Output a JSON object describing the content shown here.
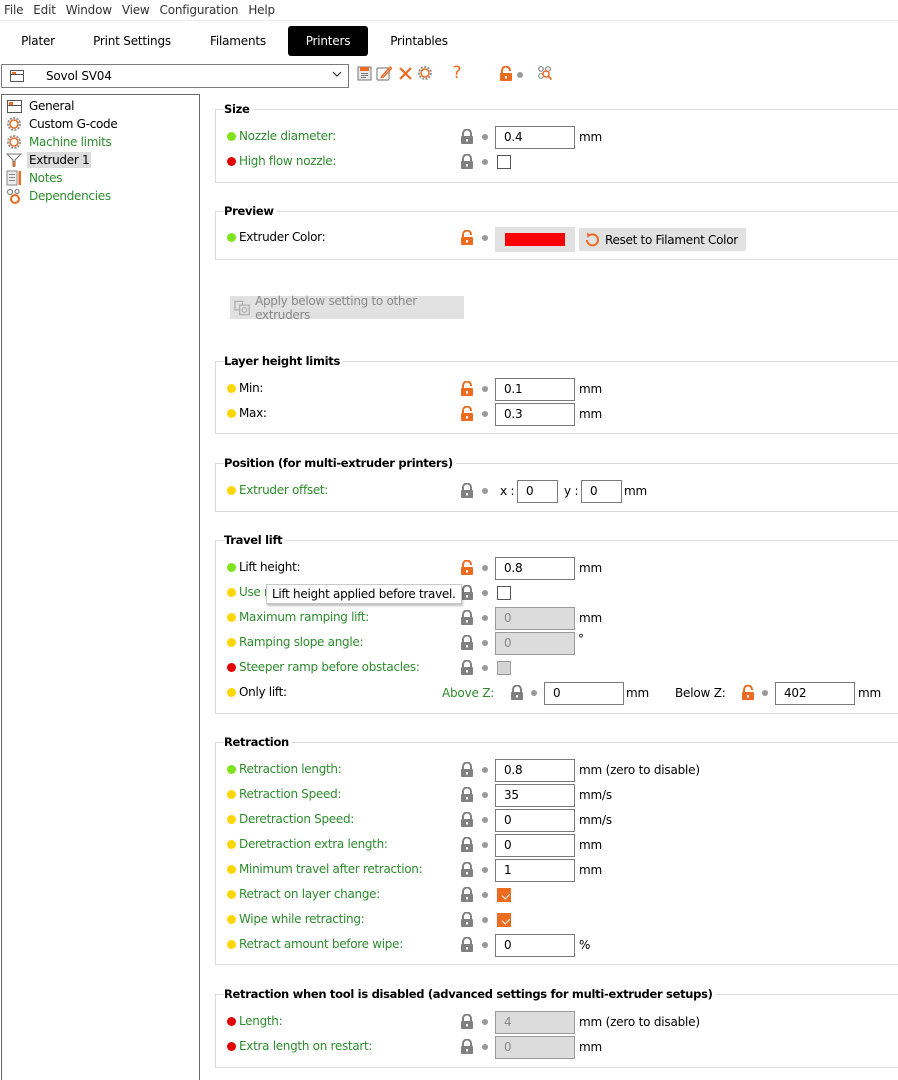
{
  "menubar": [
    "File",
    "Edit",
    "Window",
    "View",
    "Configuration",
    "Help"
  ],
  "tabs": [
    {
      "label": "Plater",
      "active": false
    },
    {
      "label": "Print Settings",
      "active": false
    },
    {
      "label": "Filaments",
      "active": false
    },
    {
      "label": "Printers",
      "active": true
    },
    {
      "label": "Printables",
      "active": false
    }
  ],
  "preset": {
    "name": "Sovol SV04",
    "toolbar_icons": [
      "save-icon",
      "edit-icon",
      "delete-icon",
      "compare-icon",
      "help-icon",
      "lock-unlocked-icon",
      "bullet-icon",
      "search-icon"
    ]
  },
  "sidebar": {
    "items": [
      {
        "label": "General",
        "icon": "printer-icon",
        "modified": false,
        "selected": false
      },
      {
        "label": "Custom G-code",
        "icon": "gear-icon",
        "modified": false,
        "selected": false
      },
      {
        "label": "Machine limits",
        "icon": "gear-icon",
        "modified": true,
        "selected": false
      },
      {
        "label": "Extruder 1",
        "icon": "funnel-icon",
        "modified": false,
        "selected": true
      },
      {
        "label": "Notes",
        "icon": "notes-icon",
        "modified": true,
        "selected": false
      },
      {
        "label": "Dependencies",
        "icon": "dependencies-icon",
        "modified": true,
        "selected": false
      }
    ]
  },
  "colors": {
    "accent": "#ed6b21",
    "modified_label": "#2e8b2e",
    "mode_simple": "#7fe41c",
    "mode_advanced": "#ffd700",
    "mode_expert": "#e00000",
    "extruder_color": "#ff0000"
  },
  "size": {
    "title": "Size",
    "nozzle_diameter": {
      "label": "Nozzle diameter:",
      "value": "0.4",
      "unit": "mm"
    },
    "high_flow_nozzle": {
      "label": "High flow nozzle:",
      "checked": false
    }
  },
  "preview": {
    "title": "Preview",
    "extruder_color": {
      "label": "Extruder Color:",
      "color": "#ff0000"
    },
    "reset_button": "Reset to Filament Color"
  },
  "apply_button": "Apply below setting to other extruders",
  "layer_height": {
    "title": "Layer height limits",
    "min": {
      "label": "Min:",
      "value": "0.1",
      "unit": "mm"
    },
    "max": {
      "label": "Max:",
      "value": "0.3",
      "unit": "mm"
    }
  },
  "position": {
    "title": "Position (for multi-extruder printers)",
    "extruder_offset": {
      "label": "Extruder offset:",
      "x_label": "x :",
      "x": "0",
      "y_label": "y :",
      "y": "0",
      "unit": "mm"
    }
  },
  "travel_lift": {
    "title": "Travel lift",
    "lift_height": {
      "label": "Lift height:",
      "value": "0.8",
      "unit": "mm"
    },
    "use_ramping": {
      "label": "Use r",
      "checked": false
    },
    "tooltip": "Lift height applied before travel.",
    "max_ramping_lift": {
      "label": "Maximum ramping lift:",
      "value": "0",
      "unit": "mm"
    },
    "ramping_slope": {
      "label": "Ramping slope angle:",
      "value": "0",
      "unit": "°"
    },
    "steeper_ramp": {
      "label": "Steeper ramp before obstacles:",
      "checked": false
    },
    "only_lift": {
      "label": "Only lift:",
      "above_label": "Above Z:",
      "above_value": "0",
      "above_unit": "mm",
      "below_label": "Below Z:",
      "below_value": "402",
      "below_unit": "mm"
    }
  },
  "retraction": {
    "title": "Retraction",
    "length": {
      "label": "Retraction length:",
      "value": "0.8",
      "unit": "mm (zero to disable)"
    },
    "speed": {
      "label": "Retraction Speed:",
      "value": "35",
      "unit": "mm/s"
    },
    "deretract_speed": {
      "label": "Deretraction Speed:",
      "value": "0",
      "unit": "mm/s"
    },
    "deretract_extra": {
      "label": "Deretraction extra length:",
      "value": "0",
      "unit": "mm"
    },
    "min_travel": {
      "label": "Minimum travel after retraction:",
      "value": "1",
      "unit": "mm"
    },
    "retract_layer_change": {
      "label": "Retract on layer change:",
      "checked": true
    },
    "wipe": {
      "label": "Wipe while retracting:",
      "checked": true
    },
    "retract_before_wipe": {
      "label": "Retract amount before wipe:",
      "value": "0",
      "unit": "%"
    }
  },
  "retraction_disabled": {
    "title": "Retraction when tool is disabled (advanced settings for multi-extruder setups)",
    "length": {
      "label": "Length:",
      "value": "4",
      "unit": "mm (zero to disable)"
    },
    "extra_length": {
      "label": "Extra length on restart:",
      "value": "0",
      "unit": "mm"
    }
  }
}
